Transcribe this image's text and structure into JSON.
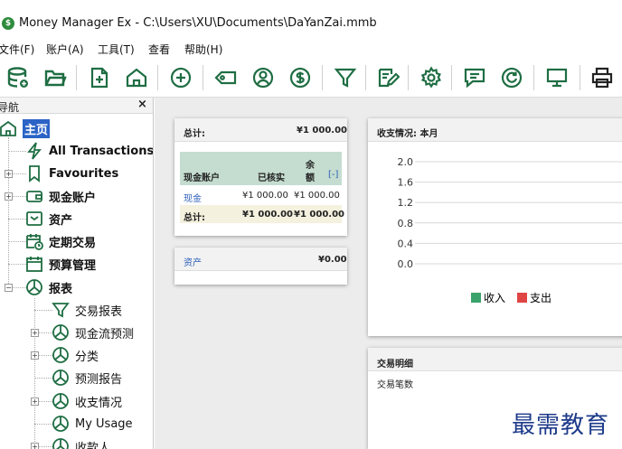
{
  "window": {
    "title": "Money Manager Ex - C:\\Users\\XU\\Documents\\DaYanZai.mmb",
    "app_icon_glyph": "$"
  },
  "menu": {
    "items": [
      "文件(F)",
      "账户(A)",
      "工具(T)",
      "查看",
      "帮助(H)"
    ]
  },
  "toolbar": {
    "buttons": [
      "database-icon",
      "folder-open-icon",
      "new-transaction-icon",
      "home-icon",
      "add-circle-icon",
      "tag-icon",
      "user-circle-icon",
      "dollar-circle-icon",
      "filter-icon",
      "edit-icon",
      "settings-gear-icon",
      "comment-icon",
      "refresh-icon",
      "monitor-icon",
      "print-icon"
    ],
    "icon_color": "#1f6e43"
  },
  "nav": {
    "header": "导航",
    "close": "×",
    "items": [
      {
        "label": "主页",
        "icon": "home-icon",
        "selected": true
      },
      {
        "label": "All Transactions",
        "icon": "lightning-icon"
      },
      {
        "label": "Favourites",
        "icon": "bookmark-icon"
      },
      {
        "label": "现金账户",
        "icon": "wallet-icon"
      },
      {
        "label": "资产",
        "icon": "asset-box-icon"
      },
      {
        "label": "定期交易",
        "icon": "calendar-clock-icon"
      },
      {
        "label": "预算管理",
        "icon": "calendar-icon"
      },
      {
        "label": "报表",
        "icon": "pie-chart-icon"
      },
      {
        "label": "交易报表",
        "icon": "filter-icon"
      },
      {
        "label": "现金流预测",
        "icon": "pie-chart-icon"
      },
      {
        "label": "分类",
        "icon": "pie-chart-icon"
      },
      {
        "label": "预测报告",
        "icon": "pie-chart-icon"
      },
      {
        "label": "收支情况",
        "icon": "pie-chart-icon"
      },
      {
        "label": "My Usage",
        "icon": "pie-chart-icon"
      },
      {
        "label": "收款人",
        "icon": "pie-chart-icon"
      }
    ]
  },
  "summary_card": {
    "total_label": "总计:",
    "total_value": "¥1 000.00",
    "col_account": "现金账户",
    "col_reconciled": "已核实",
    "col_balance_1": "余",
    "col_balance_2": "额",
    "col_toggle": "[-]",
    "rows": [
      {
        "account": "现金",
        "reconciled": "¥1 000.00",
        "balance": "¥1 000.00"
      }
    ],
    "footer_label": "总计:",
    "footer_reconciled": "¥1 000.00",
    "footer_balance": "¥1 000.00"
  },
  "assets_card": {
    "label": "资产",
    "value": "¥0.00"
  },
  "income_card": {
    "title": "收支情况: 本月",
    "legend_income": "收入",
    "legend_expense": "支出",
    "income_color": "#3aa36b",
    "expense_color": "#e04545"
  },
  "chart_data": {
    "type": "bar",
    "title": "",
    "categories": [],
    "series": [
      {
        "name": "收入",
        "values": []
      },
      {
        "name": "支出",
        "values": []
      }
    ],
    "yticks": [
      "2.0",
      "1.6",
      "1.2",
      "0.8",
      "0.4",
      "0.0"
    ],
    "ylim": [
      0,
      2.0
    ],
    "grid": true,
    "legend": "bottom"
  },
  "transactions_card": {
    "title": "交易明细",
    "count_label": "交易笔数"
  },
  "watermark": "最需教育"
}
